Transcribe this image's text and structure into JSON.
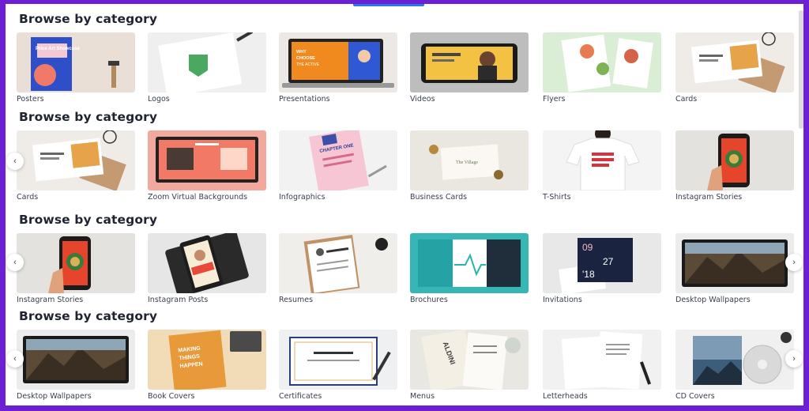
{
  "section_title": "Browse by category",
  "sections": [
    {
      "title": "Browse by category",
      "items": [
        {
          "label": "Posters",
          "thumb": "poster"
        },
        {
          "label": "Logos",
          "thumb": "logo"
        },
        {
          "label": "Presentations",
          "thumb": "presentation"
        },
        {
          "label": "Videos",
          "thumb": "video"
        },
        {
          "label": "Flyers",
          "thumb": "flyer"
        },
        {
          "label": "Cards",
          "thumb": "card"
        }
      ]
    },
    {
      "title": "Browse by category",
      "items": [
        {
          "label": "Cards",
          "thumb": "card"
        },
        {
          "label": "Zoom Virtual Backgrounds",
          "thumb": "zoom"
        },
        {
          "label": "Infographics",
          "thumb": "infographic"
        },
        {
          "label": "Business Cards",
          "thumb": "businesscard"
        },
        {
          "label": "T-Shirts",
          "thumb": "tshirt"
        },
        {
          "label": "Instagram Stories",
          "thumb": "story"
        }
      ]
    },
    {
      "title": "Browse by category",
      "items": [
        {
          "label": "Instagram Stories",
          "thumb": "story"
        },
        {
          "label": "Instagram Posts",
          "thumb": "igpost"
        },
        {
          "label": "Resumes",
          "thumb": "resume"
        },
        {
          "label": "Brochures",
          "thumb": "brochure"
        },
        {
          "label": "Invitations",
          "thumb": "invitation"
        },
        {
          "label": "Desktop Wallpapers",
          "thumb": "wallpaper"
        }
      ]
    },
    {
      "title": "Browse by category",
      "items": [
        {
          "label": "Desktop Wallpapers",
          "thumb": "wallpaper"
        },
        {
          "label": "Book Covers",
          "thumb": "book"
        },
        {
          "label": "Certificates",
          "thumb": "certificate"
        },
        {
          "label": "Menus",
          "thumb": "menu"
        },
        {
          "label": "Letterheads",
          "thumb": "letterhead"
        },
        {
          "label": "CD Covers",
          "thumb": "cd"
        }
      ]
    }
  ],
  "thumb_text": {
    "poster": "Price Art Showcase",
    "presentation": "WHY CHOOSE THE ACTIVE LIFESTYLE",
    "infographic": "CHAPTER ONE",
    "businesscard": "The Village",
    "tshirt": "ENTER STUDENTS ASSEMBLY",
    "igpost": "NEW FASHION PIECE",
    "invitation_date": [
      "09",
      "27",
      "18"
    ],
    "book": "MAKING THINGS HAPPEN",
    "menu": "ALDINI CUISINE"
  },
  "arrows": {
    "left": "‹",
    "right": "›"
  },
  "colors": {
    "frame": "#6d1fd6",
    "accent": "#2b77e8",
    "heading": "#1f2430"
  }
}
